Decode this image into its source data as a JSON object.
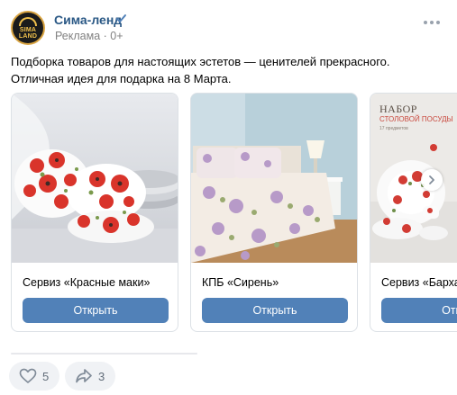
{
  "post": {
    "author": "Сима-ленд",
    "meta": "Реклама · 0+",
    "avatar_text": "SIMA\nLAND",
    "text": "Подборка товаров для настоящих эстетов — ценителей прекрасного. Отличная идея для подарка на 8 Марта."
  },
  "cards": [
    {
      "title": "Сервиз «Красные маки»",
      "button": "Открыть"
    },
    {
      "title": "КПБ «Сирень»",
      "button": "Открыть"
    },
    {
      "title": "Сервиз «Барха",
      "button": "Откр",
      "banner_line1": "НАБОР",
      "banner_line2": "СТОЛОВОЙ ПОСУДЫ",
      "banner_line3": "17 предметов"
    }
  ],
  "actions": {
    "likes": "5",
    "shares": "3"
  },
  "icons": [
    "verified-icon",
    "more-icon",
    "chevron-right-icon",
    "heart-icon",
    "share-icon"
  ],
  "colors": {
    "link": "#2a5885",
    "accent": "#5181b8",
    "muted": "#828282"
  }
}
